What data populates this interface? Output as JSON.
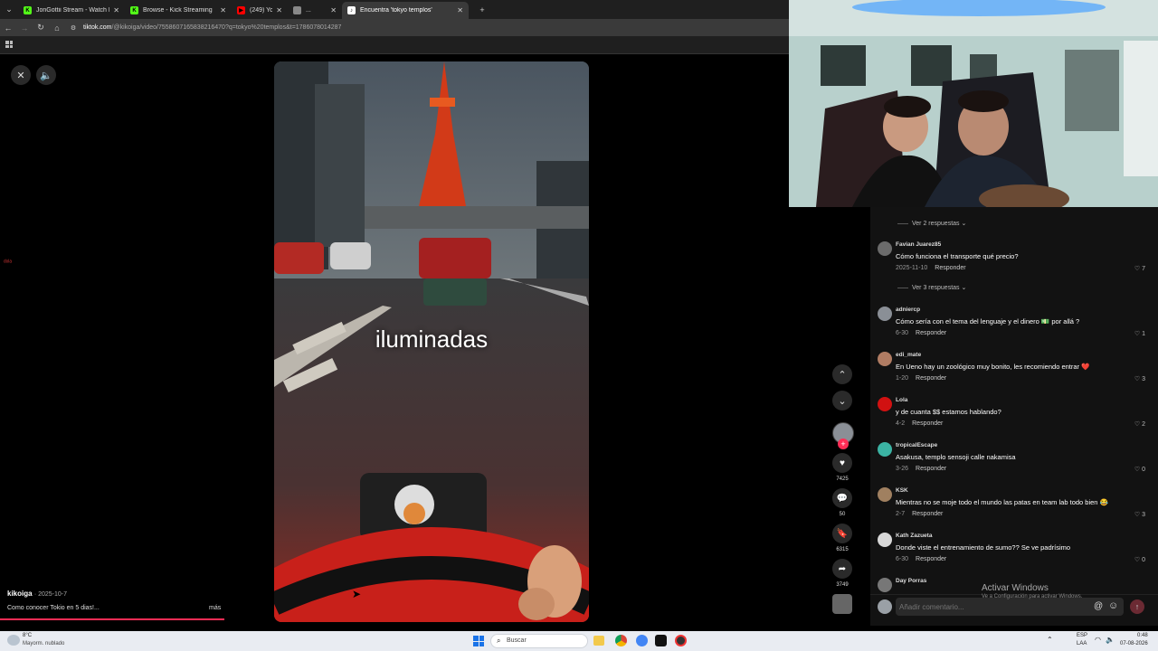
{
  "browser": {
    "tabs": [
      {
        "label": "JonGottii Stream - Watch Live o",
        "favicon": "K",
        "color": "#53fc18",
        "active": false
      },
      {
        "label": "Browse - Kick Streaming",
        "favicon": "K",
        "color": "#53fc18",
        "active": false
      },
      {
        "label": "(249) YouTube",
        "favicon": "▶",
        "color": "#ff0000",
        "active": false
      },
      {
        "label": "...",
        "favicon": "",
        "color": "#888888",
        "active": false
      },
      {
        "label": "Encuentra 'tokyo templos'",
        "favicon": "♪",
        "color": "#ffffff",
        "active": true
      }
    ],
    "new_tab": "+",
    "url_domain": "tiktok.com",
    "url_path": "/@kikoiga/video/7558607165838216470?q=tokyo%20templos&t=1786078014287"
  },
  "player": {
    "close_icon": "close-icon",
    "volume_icon": "volume-icon",
    "caption": "iluminadas",
    "author": "kikoiga",
    "date": "· 2025-10-7",
    "description": "Como conocer Tokio en 5 dias!...",
    "more": "más",
    "left_label": "ᵈᵒˡᵃ"
  },
  "rail": {
    "likes": "7425",
    "comments": "50",
    "saves": "6315",
    "shares": "3749"
  },
  "comments": {
    "top_replies": "Ver 2 respuestas",
    "items": [
      {
        "user": "Favian Juarez85",
        "text": "Cómo funciona el transporte qué precio?",
        "date": "2025-11-10",
        "reply": "Responder",
        "likes": "7",
        "avatar": "#6b6b6b",
        "replies": "Ver 3 respuestas"
      },
      {
        "user": "adniercp",
        "text": "Cómo sería con el tema del lenguaje y el dinero 💵 por allá ?",
        "date": "6-30",
        "reply": "Responder",
        "likes": "1",
        "avatar": "#8a8f96"
      },
      {
        "user": "edi_mate",
        "text": "En Ueno hay un zoológico muy bonito, les recomiendo entrar ❤️",
        "date": "1-20",
        "reply": "Responder",
        "likes": "3",
        "avatar": "#b07c63"
      },
      {
        "user": "Lola",
        "text": "y de cuanta $$ estamos hablando?",
        "date": "4-2",
        "reply": "Responder",
        "likes": "2",
        "avatar": "#d11111"
      },
      {
        "user": "tropicalEscape",
        "text": "Asakusa, templo sensoji calle nakamisa",
        "date": "3-26",
        "reply": "Responder",
        "likes": "0",
        "avatar": "#3bb3a3"
      },
      {
        "user": "KSK",
        "text": "Mientras no se moje todo el mundo las patas en team lab todo bien 😂",
        "date": "2-7",
        "reply": "Responder",
        "likes": "3",
        "avatar": "#a08060"
      },
      {
        "user": "Kath Zazueta",
        "text": "Donde viste el entrenamiento de sumo?? Se ve padrísimo",
        "date": "6-30",
        "reply": "Responder",
        "likes": "0",
        "avatar": "#d8d8d8"
      },
      {
        "user": "Day Porras",
        "text": "",
        "date": "",
        "reply": "",
        "likes": "",
        "avatar": "#777777"
      }
    ],
    "input_placeholder": "Añadir comentario...",
    "at_icon": "@",
    "emoji_icon": "☺",
    "watermark_title": "Activar Windows",
    "watermark_sub": "Ve a Configuración para activar Windows."
  },
  "taskbar": {
    "weather_temp": "8°C",
    "weather_desc": "Mayorm. nublado",
    "search": "Buscar",
    "lang_top": "ESP",
    "lang_bottom": "LAA",
    "time": "0:48",
    "date": "07-08-2026"
  }
}
